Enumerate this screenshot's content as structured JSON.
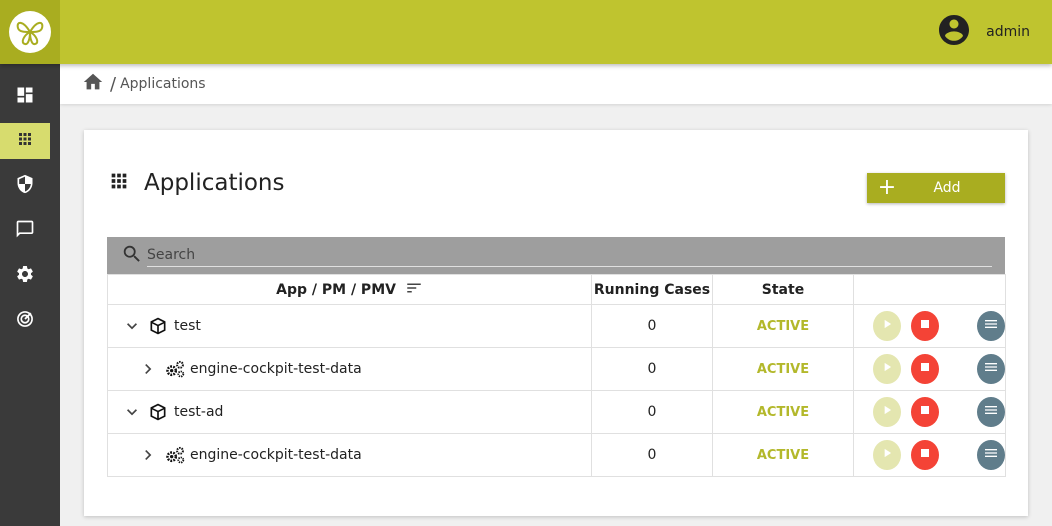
{
  "header": {
    "user_name": "admin"
  },
  "sidebar": {
    "items": [
      {
        "icon": "dashboard-icon"
      },
      {
        "icon": "apps-grid-icon",
        "active": true
      },
      {
        "icon": "shield-icon"
      },
      {
        "icon": "message-icon"
      },
      {
        "icon": "gear-icon"
      },
      {
        "icon": "monitor-icon"
      }
    ]
  },
  "breadcrumb": {
    "current": "Applications"
  },
  "page": {
    "title": "Applications",
    "add_label": "Add",
    "search_placeholder": "Search"
  },
  "table": {
    "headers": {
      "name": "App / PM / PMV",
      "cases": "Running Cases",
      "state": "State"
    },
    "rows": [
      {
        "name": "test",
        "cases": "0",
        "state": "ACTIVE"
      },
      {
        "name": "engine-cockpit-test-data",
        "cases": "0",
        "state": "ACTIVE"
      },
      {
        "name": "test-ad",
        "cases": "0",
        "state": "ACTIVE"
      },
      {
        "name": "engine-cockpit-test-data",
        "cases": "0",
        "state": "ACTIVE"
      }
    ]
  },
  "colors": {
    "brand": "#bfc42f",
    "brand_dark": "#a9ad20",
    "sidebar": "#3a3a3a",
    "stop": "#f44336",
    "menu": "#607d8b"
  }
}
